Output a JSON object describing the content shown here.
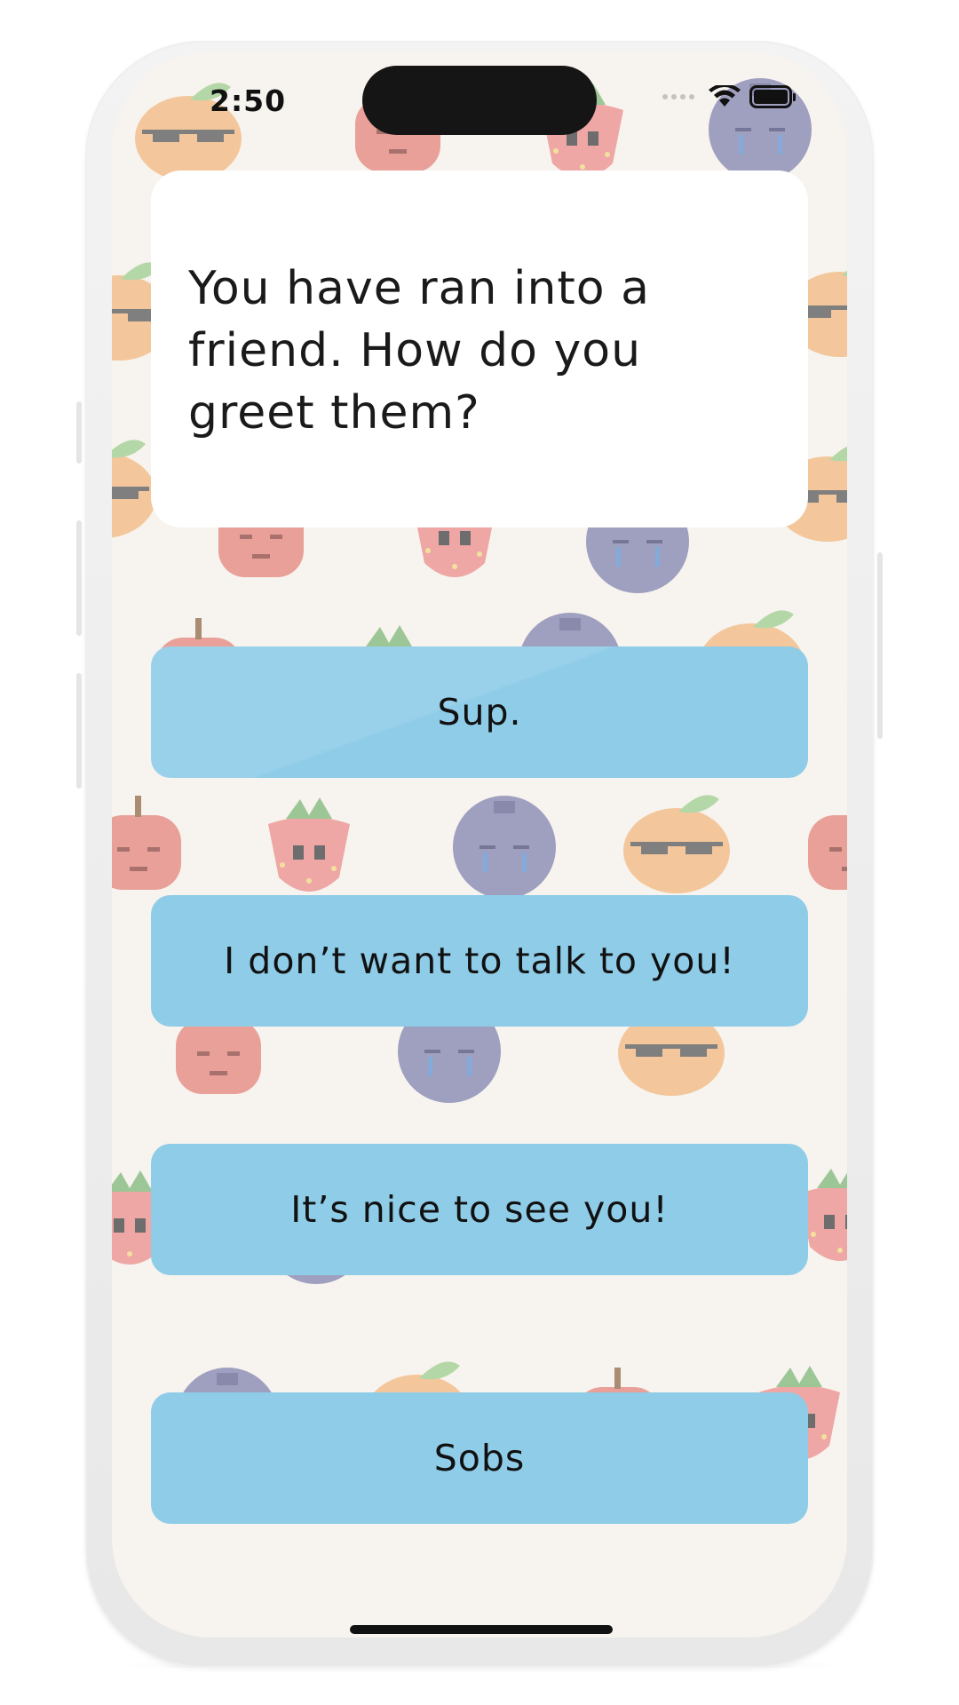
{
  "status_bar": {
    "time": "2:50",
    "icons": [
      "signal-dots-icon",
      "wifi-icon",
      "battery-icon"
    ]
  },
  "question": {
    "text": "You have ran into a friend. How do you greet them?"
  },
  "answers": [
    {
      "label": "Sup."
    },
    {
      "label": "I don’t want to talk to you!"
    },
    {
      "label": "It’s nice to see you!"
    },
    {
      "label": "Sobs"
    }
  ],
  "background": {
    "pattern": [
      "apple-icon",
      "strawberry-icon",
      "blueberry-icon",
      "orange-icon"
    ]
  },
  "colors": {
    "screen_bg": "#f7f3ee",
    "answer_button": "#8fcce8",
    "card": "#ffffff",
    "apple": "#e7928a",
    "strawberry": "#ec9a96",
    "blueberry": "#8f91b8",
    "orange": "#f2c08c"
  }
}
